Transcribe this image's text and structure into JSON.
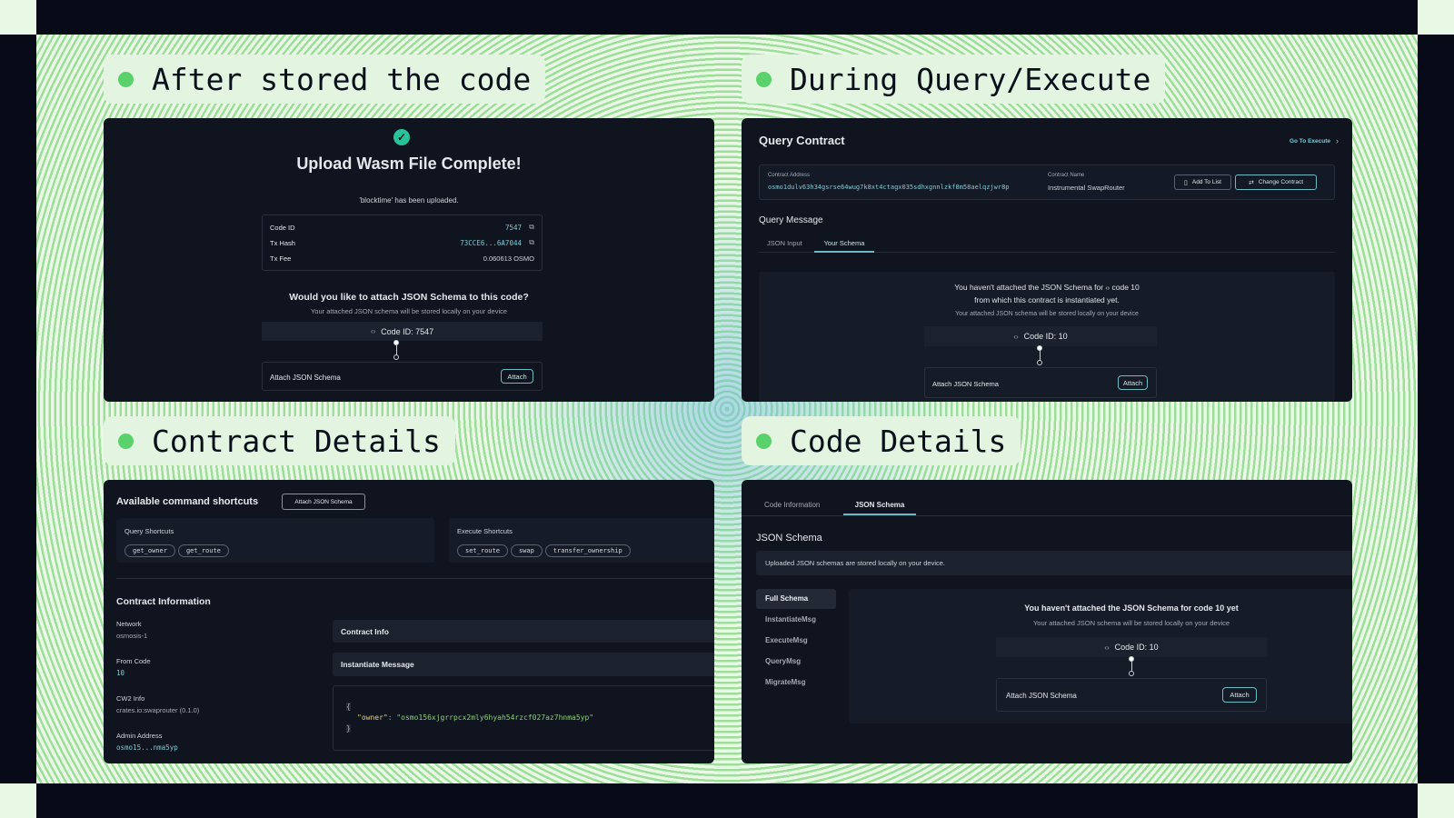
{
  "colors": {
    "accent": "#5ad16a",
    "cyan": "#7ecbd6",
    "panel_bg": "#0f141e"
  },
  "titles": {
    "top_left": "After stored the code",
    "top_right": "During Query/Execute",
    "bottom_left": "Contract Details",
    "bottom_right": "Code Details"
  },
  "upload": {
    "check_icon": "check-circle-icon",
    "heading": "Upload Wasm File Complete!",
    "subtitle": "'blocktime' has been uploaded.",
    "rows": [
      {
        "label": "Code ID",
        "value": "7547"
      },
      {
        "label": "Tx Hash",
        "value": "73CCE6...6A7044"
      },
      {
        "label": "Tx Fee",
        "value": "0.060613 OSMO"
      }
    ],
    "question": "Would you like to attach JSON Schema to this code?",
    "note": "Your attached JSON schema will be stored locally on your device",
    "code_label": "Code ID: 7547",
    "attach_label": "Attach JSON Schema",
    "attach_button": "Attach"
  },
  "query": {
    "heading": "Query Contract",
    "go_execute": "Go To Execute",
    "contract_address_label": "Contract Address",
    "contract_address": "osmo1dulv63h34gsrse64wug7k8xt4ctagx035sdhxgnnlzkf8m58aelqzjwr8p",
    "contract_name_label": "Contract Name",
    "contract_name": "Instrumental SwapRouter",
    "add_to_list": "Add To List",
    "change_contract": "Change Contract",
    "message_heading": "Query Message",
    "tabs": [
      "JSON Input",
      "Your Schema"
    ],
    "notice_line1": "You haven't attached the JSON Schema for",
    "notice_code": "code 10",
    "notice_line2": "from which this contract is instantiated yet.",
    "note": "Your attached JSON schema will be stored locally on your device",
    "code_label": "Code ID: 10",
    "attach_label": "Attach JSON Schema",
    "attach_button": "Attach"
  },
  "contract": {
    "shortcuts_heading": "Available command shortcuts",
    "attach_schema_button": "Attach JSON Schema",
    "query_shortcuts_label": "Query Shortcuts",
    "query_shortcuts": [
      "get_owner",
      "get_route"
    ],
    "execute_shortcuts_label": "Execute Shortcuts",
    "execute_shortcuts": [
      "set_route",
      "swap",
      "transfer_ownership"
    ],
    "info_heading": "Contract Information",
    "network_label": "Network",
    "network": "osmosis-1",
    "from_code_label": "From Code",
    "from_code": "10",
    "cw2_label": "CW2 Info",
    "cw2": "crates.io:swaprouter (0.1.0)",
    "admin_label": "Admin Address",
    "admin": "osmo15...nma5yp",
    "contract_info_label": "Contract Info",
    "instantiate_label": "Instantiate Message",
    "json_open": "{",
    "json_key": "\"owner\"",
    "json_value": "\"osmo156xjgrrpcx2mly6hyah54rzcf027az7hnma5yp\"",
    "json_close": "}"
  },
  "code": {
    "tabs": [
      "Code Information",
      "JSON Schema"
    ],
    "heading": "JSON Schema",
    "banner": "Uploaded JSON schemas are stored locally on your device.",
    "side_items": [
      "Full Schema",
      "InstantiateMsg",
      "ExecuteMsg",
      "QueryMsg",
      "MigrateMsg"
    ],
    "notice": "You haven't attached the JSON Schema for code 10 yet",
    "note": "Your attached JSON schema will be stored locally on your device",
    "code_label": "Code ID: 10",
    "attach_label": "Attach JSON Schema",
    "attach_button": "Attach"
  }
}
